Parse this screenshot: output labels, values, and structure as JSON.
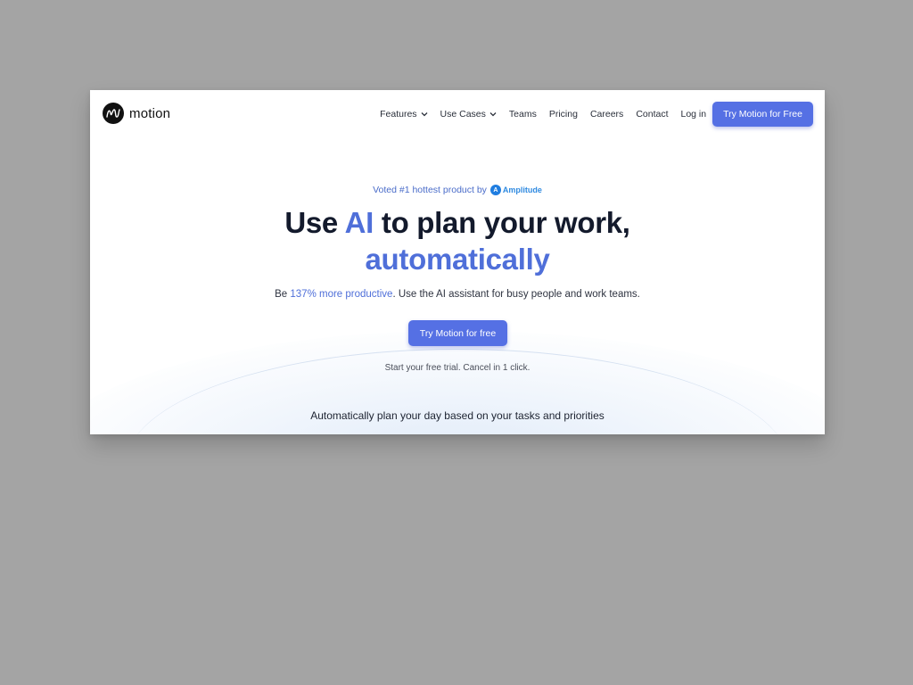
{
  "nav": {
    "logo_text": "motion",
    "items": [
      {
        "label": "Features",
        "has_dropdown": true
      },
      {
        "label": "Use Cases",
        "has_dropdown": true
      },
      {
        "label": "Teams",
        "has_dropdown": false
      },
      {
        "label": "Pricing",
        "has_dropdown": false
      },
      {
        "label": "Careers",
        "has_dropdown": false
      },
      {
        "label": "Contact",
        "has_dropdown": false
      }
    ],
    "login_label": "Log in",
    "cta_label": "Try Motion for Free"
  },
  "hero": {
    "badge_text": "Voted #1 hottest product by",
    "badge_brand": "Amplitude",
    "headline_part1": "Use ",
    "headline_accent1": "AI",
    "headline_part2": " to plan your work,",
    "headline_accent2": "automatically",
    "subline_prefix": "Be ",
    "subline_accent": "137% more productive",
    "subline_suffix": ". Use the AI assistant for busy people and work teams.",
    "cta_label": "Try Motion for free",
    "trial_note": "Start your free trial. Cancel in 1 click.",
    "section_caption": "Automatically plan your day based on your tasks and priorities"
  },
  "colors": {
    "accent": "#5570e4",
    "accent_text": "#4f6fd9",
    "background_outer": "#a4a4a4",
    "text_dark": "#131a2c"
  },
  "icons": {
    "logo": "motion-logo-icon",
    "dropdown": "chevron-down-icon",
    "amplitude": "amplitude-logo-icon"
  }
}
